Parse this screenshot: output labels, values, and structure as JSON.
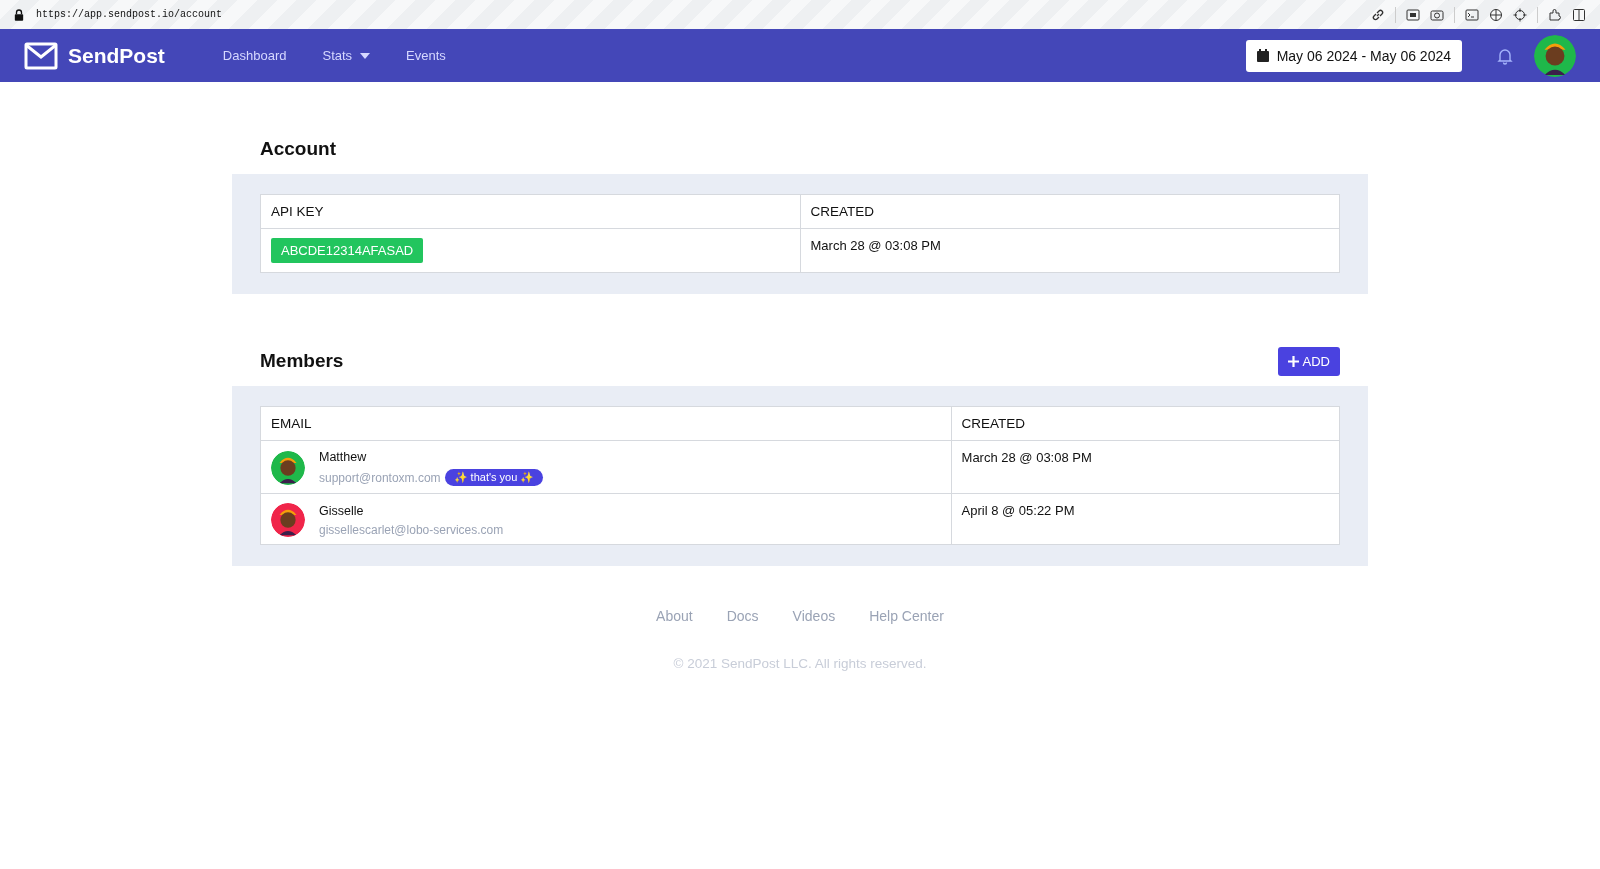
{
  "browser": {
    "url": "https://app.sendpost.io/account"
  },
  "nav": {
    "brand": "SendPost",
    "items": [
      {
        "label": "Dashboard",
        "dropdown": false
      },
      {
        "label": "Stats",
        "dropdown": true
      },
      {
        "label": "Events",
        "dropdown": false
      }
    ],
    "date_range": "May 06 2024 - May 06 2024"
  },
  "account": {
    "title": "Account",
    "columns": [
      "API KEY",
      "CREATED"
    ],
    "api_key": "ABCDE12314AFASAD",
    "created": "March 28 @ 03:08 PM"
  },
  "members": {
    "title": "Members",
    "add_button": "ADD",
    "columns": [
      "EMAIL",
      "CREATED"
    ],
    "rows": [
      {
        "name": "Matthew",
        "email": "support@rontoxm.com",
        "badge": "✨ that's you ✨",
        "created": "March 28 @ 03:08 PM",
        "color": "#1fb84a"
      },
      {
        "name": "Gisselle",
        "email": "gissellescarlet@lobo-services.com",
        "created": "April 8 @ 05:22 PM",
        "color": "#f0254a"
      }
    ]
  },
  "footer": {
    "links": [
      "About",
      "Docs",
      "Videos",
      "Help Center"
    ],
    "copyright": "© 2021 SendPost LLC. All rights reserved."
  }
}
